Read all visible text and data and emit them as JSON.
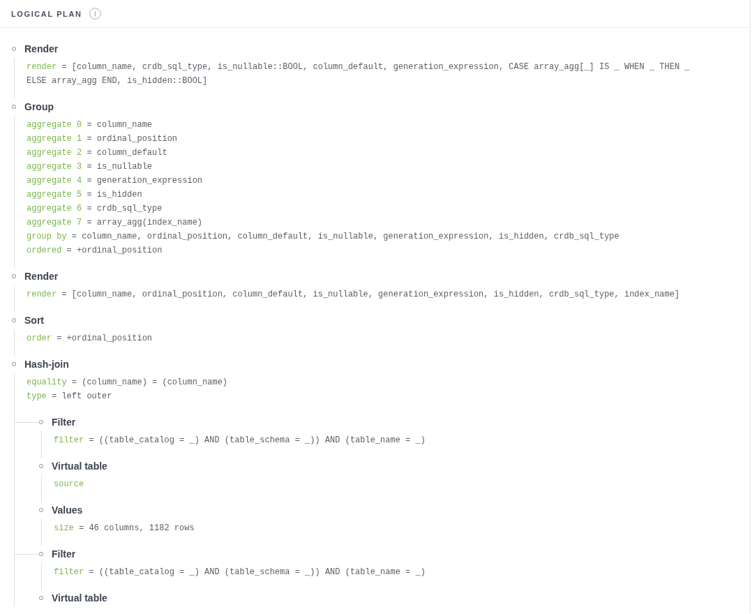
{
  "header": {
    "title": "LOGICAL PLAN"
  },
  "plan": {
    "title": "Render",
    "attributes": [
      {
        "key": "render",
        "value": "= [column_name, crdb_sql_type, is_nullable::BOOL, column_default, generation_expression, CASE array_agg[_] IS _ WHEN _ THEN _ ELSE array_agg END, is_hidden::BOOL]"
      }
    ],
    "children": [
      {
        "title": "Group",
        "attributes": [
          {
            "key": "aggregate 0",
            "value": "= column_name"
          },
          {
            "key": "aggregate 1",
            "value": "= ordinal_position"
          },
          {
            "key": "aggregate 2",
            "value": "= column_default"
          },
          {
            "key": "aggregate 3",
            "value": "= is_nullable"
          },
          {
            "key": "aggregate 4",
            "value": "= generation_expression"
          },
          {
            "key": "aggregate 5",
            "value": "= is_hidden"
          },
          {
            "key": "aggregate 6",
            "value": "= crdb_sql_type"
          },
          {
            "key": "aggregate 7",
            "value": "= array_agg(index_name)"
          },
          {
            "key": "group by",
            "value": "= column_name, ordinal_position, column_default, is_nullable, generation_expression, is_hidden, crdb_sql_type"
          },
          {
            "key": "ordered",
            "value": "= +ordinal_position"
          }
        ],
        "children": [
          {
            "title": "Render",
            "attributes": [
              {
                "key": "render",
                "value": "= [column_name, ordinal_position, column_default, is_nullable, generation_expression, is_hidden, crdb_sql_type, index_name]"
              }
            ],
            "children": [
              {
                "title": "Sort",
                "attributes": [
                  {
                    "key": "order",
                    "value": "= +ordinal_position"
                  }
                ],
                "children": [
                  {
                    "title": "Hash-join",
                    "attributes": [
                      {
                        "key": "equality",
                        "value": "= (column_name) = (column_name)"
                      },
                      {
                        "key": "type",
                        "value": "= left outer"
                      }
                    ],
                    "children": [
                      {
                        "title": "Filter",
                        "attributes": [
                          {
                            "key": "filter",
                            "value": "= ((table_catalog = _) AND (table_schema = _)) AND (table_name = _)"
                          }
                        ],
                        "children": [
                          {
                            "title": "Virtual table",
                            "attributes": [
                              {
                                "key": "source"
                              }
                            ],
                            "children": [
                              {
                                "title": "Values",
                                "attributes": [
                                  {
                                    "key": "size",
                                    "value": "= 46 columns, 1182 rows"
                                  }
                                ]
                              }
                            ]
                          }
                        ]
                      },
                      {
                        "title": "Filter",
                        "attributes": [
                          {
                            "key": "filter",
                            "value": "= ((table_catalog = _) AND (table_schema = _)) AND (table_name = _)"
                          }
                        ],
                        "children": [
                          {
                            "title": "Virtual table"
                          }
                        ]
                      }
                    ]
                  }
                ]
              }
            ]
          }
        ]
      }
    ]
  }
}
